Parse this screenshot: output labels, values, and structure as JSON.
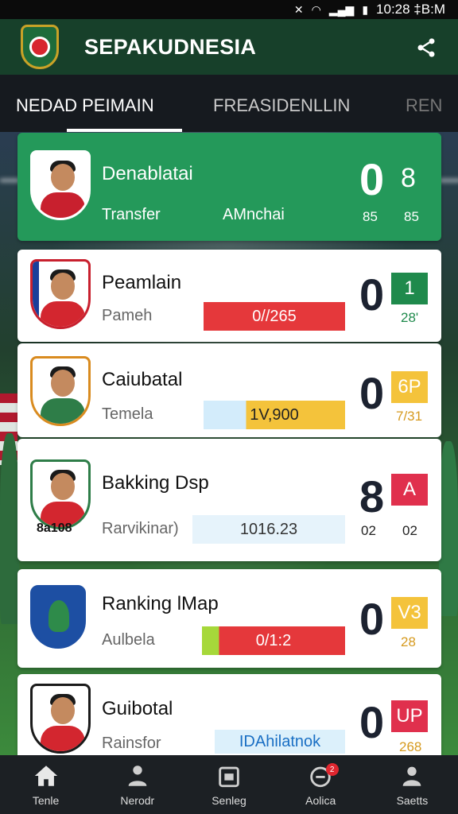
{
  "status_bar": {
    "time": "10:28 ‡B:M"
  },
  "app": {
    "title": "SEPAKUDNESIA"
  },
  "tabs": [
    {
      "label": "NEDAD PEIMAIN",
      "active": true
    },
    {
      "label": "FREASIDENLLIN",
      "active": false
    },
    {
      "label": "REN",
      "active": false
    }
  ],
  "featured": {
    "name": "Denablatai",
    "sub_left": "Transfer",
    "sub_right": "AMnchai",
    "score_a": "0",
    "score_b": "8",
    "num_a": "85",
    "num_b": "85"
  },
  "cards": [
    {
      "name": "Peamlain",
      "sub": "Pameh",
      "bar_text": "0//265",
      "score": "0",
      "badge": "1",
      "badge_color": "#1f8a4c",
      "below_badge": "28'",
      "below_color": "#1f8a4c"
    },
    {
      "name": "Caiubatal",
      "sub": "Temela",
      "bar_text": "1V,900",
      "score": "0",
      "badge": "6P",
      "badge_color": "#f4c33b",
      "below_badge": "7/31",
      "below_color": "#d69a1f"
    },
    {
      "name": "Bakking Dsp",
      "sub": "Rarvikinar)",
      "bar_text": "1016.23",
      "score": "8",
      "badge": "A",
      "badge_color": "#e0304d",
      "num_a": "02",
      "num_b": "02",
      "avatar_caption": "8a108"
    },
    {
      "name": "Ranking lMap",
      "sub": "Aulbela",
      "bar_text": "0/1:2",
      "score": "0",
      "badge": "V3",
      "badge_color": "#f4c33b",
      "below_badge": "28",
      "below_color": "#d69a1f"
    },
    {
      "name": "Guibotal",
      "sub": "Rainsfor",
      "bar_text": "IDAhilatnok",
      "score": "0",
      "badge": "UP",
      "badge_color": "#e0304d",
      "below_badge": "268",
      "below_color": "#d69a1f"
    }
  ],
  "bottom_nav": [
    {
      "label": "Tenle",
      "icon": "home-icon"
    },
    {
      "label": "Nerodr",
      "icon": "people-icon"
    },
    {
      "label": "Senleg",
      "icon": "calendar-icon"
    },
    {
      "label": "Aolica",
      "icon": "ball-icon",
      "badge": "2"
    },
    {
      "label": "Saetts",
      "icon": "profile-icon"
    }
  ]
}
